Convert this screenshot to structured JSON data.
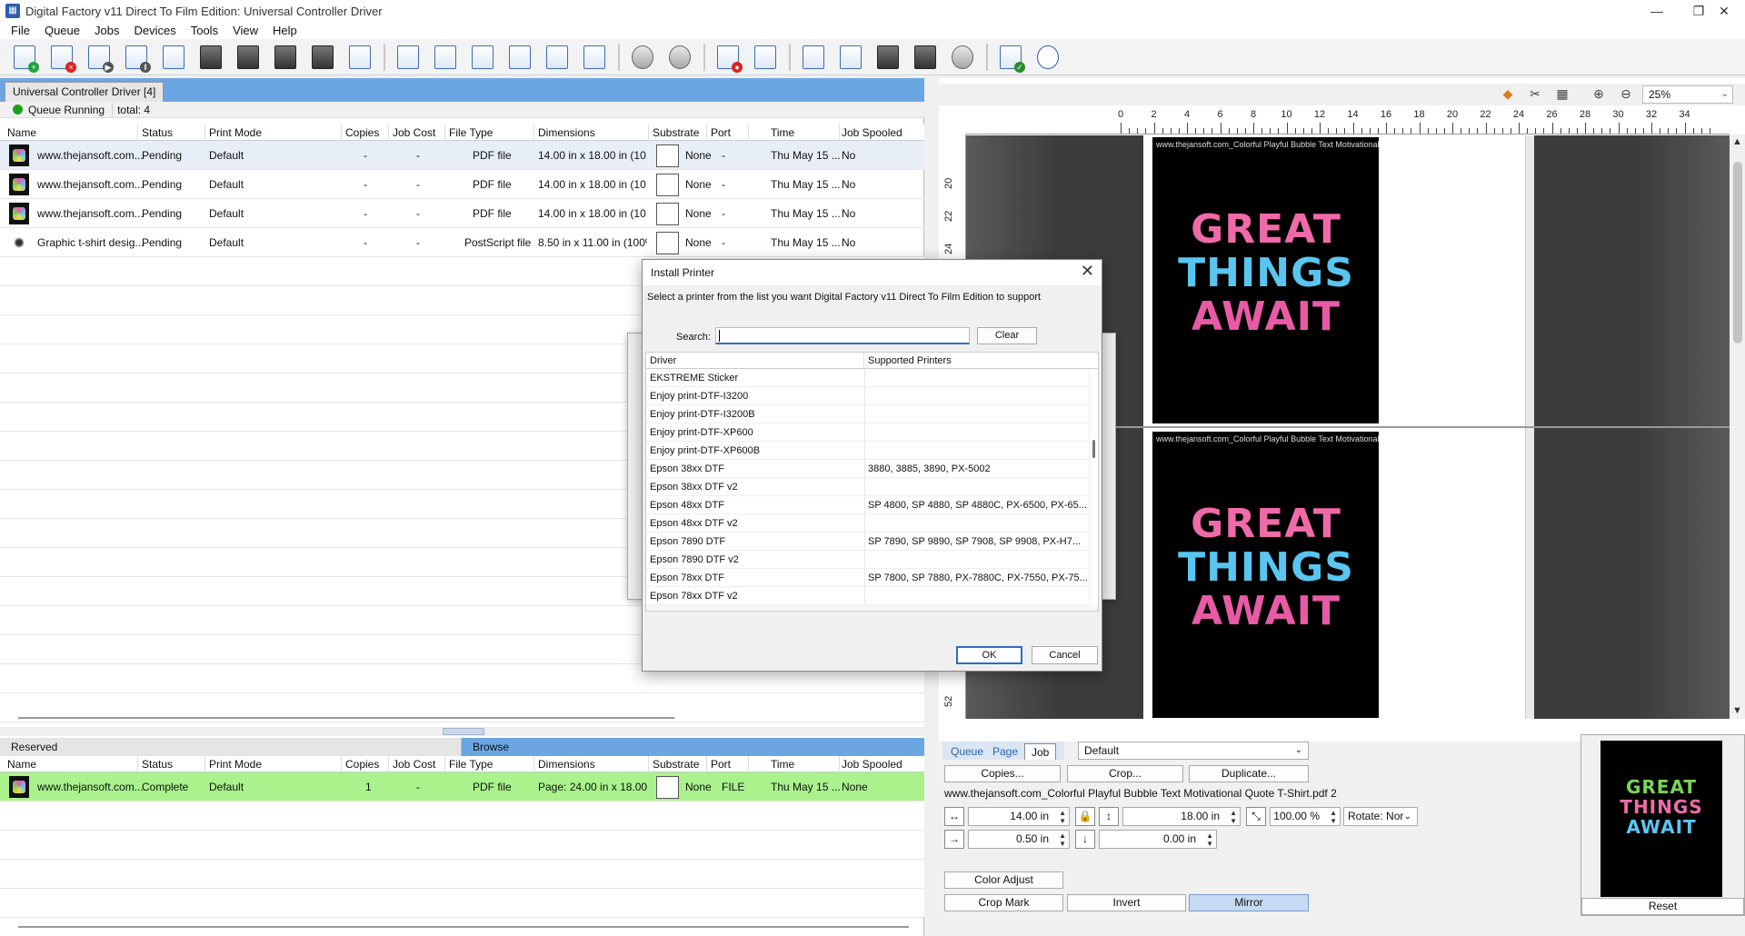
{
  "window": {
    "title": "Digital Factory v11 Direct To Film Edition: Universal Controller Driver",
    "minimize": "—",
    "maximize": "❐",
    "close": "✕"
  },
  "menu": [
    "File",
    "Queue",
    "Jobs",
    "Devices",
    "Tools",
    "View",
    "Help"
  ],
  "toolbar_icons": [
    "add-job-icon",
    "delete-job-icon",
    "play-job-icon",
    "pause-job-icon",
    "copy-job-icon",
    "print-color-icon",
    "rip-icon",
    "edit-pen-icon",
    "printer-pen-icon",
    "window-icon",
    "align-left-icon",
    "align-center-icon",
    "arrow-right-icon",
    "fit-height-icon",
    "fit-both-icon",
    "rotate-icon",
    "stop-gear-icon",
    "cancel-icon",
    "hold-queue-icon",
    "queue-settings-icon",
    "list-icon",
    "checklist-icon",
    "printer-icon",
    "printer-settings-icon",
    "palette-icon",
    "preview-icon",
    "compass-icon"
  ],
  "queue": {
    "tab_label": "Universal Controller Driver [4]",
    "status_text": "Queue Running",
    "total_text": "total: 4",
    "columns": [
      "Name",
      "Status",
      "Print Mode",
      "Copies",
      "Job Cost",
      "File Type",
      "Dimensions",
      "Substrate",
      "Port",
      "Time",
      "Job Spooled"
    ],
    "rows": [
      {
        "name": "www.thejansoft.com...",
        "status": "Pending",
        "mode": "Default",
        "copies": "-",
        "cost": "-",
        "type": "PDF file",
        "dims": "14.00 in x 18.00 in (10...",
        "substrate": "None",
        "port": "-",
        "time": "Thu May 15 ...",
        "spooled": "No"
      },
      {
        "name": "www.thejansoft.com...",
        "status": "Pending",
        "mode": "Default",
        "copies": "-",
        "cost": "-",
        "type": "PDF file",
        "dims": "14.00 in x 18.00 in (10...",
        "substrate": "None",
        "port": "-",
        "time": "Thu May 15 ...",
        "spooled": "No"
      },
      {
        "name": "www.thejansoft.com...",
        "status": "Pending",
        "mode": "Default",
        "copies": "-",
        "cost": "-",
        "type": "PDF file",
        "dims": "14.00 in x 18.00 in (10...",
        "substrate": "None",
        "port": "-",
        "time": "Thu May 15 ...",
        "spooled": "No"
      },
      {
        "name": "Graphic t-shirt desig...",
        "status": "Pending",
        "mode": "Default",
        "copies": "-",
        "cost": "-",
        "type": "PostScript file",
        "dims": "8.50 in x 11.00 in (100%)",
        "substrate": "None",
        "port": "-",
        "time": "Thu May 15 ...",
        "spooled": "No"
      }
    ]
  },
  "reserved": {
    "tab_label": "Reserved",
    "browse_label": "Browse",
    "columns": [
      "Name",
      "Status",
      "Print Mode",
      "Copies",
      "Job Cost",
      "File Type",
      "Dimensions",
      "Substrate",
      "Port",
      "Time",
      "Job Spooled"
    ],
    "rows": [
      {
        "name": "www.thejansoft.com...",
        "status": "Complete",
        "mode": "Default",
        "copies": "1",
        "cost": "-",
        "type": "PDF file",
        "dims": "Page: 24.00 in x 18.00...",
        "substrate": "None",
        "port": "FILE",
        "time": "Thu May 15 ...",
        "spooled": "None"
      }
    ]
  },
  "preview_pane": {
    "zoom": "25%",
    "ruler_h": [
      "0",
      "2",
      "4",
      "6",
      "8",
      "10",
      "12",
      "14",
      "16",
      "18",
      "20",
      "22",
      "24",
      "26",
      "28",
      "30",
      "32",
      "34"
    ],
    "ruler_v": [
      "20",
      "22",
      "24",
      "52"
    ],
    "design_caption": "www.thejansoft.com_Colorful Playful Bubble Text Motivational Qu...",
    "art_lines": [
      "GREAT",
      "THINGS",
      "AWAIT"
    ]
  },
  "properties": {
    "tabs": [
      "Queue",
      "Page",
      "Job"
    ],
    "active_tab": "Job",
    "profile": "Default",
    "copies_btn": "Copies...",
    "crop_btn": "Crop...",
    "duplicate_btn": "Duplicate...",
    "filename": "www.thejansoft.com_Colorful Playful Bubble Text Motivational Quote T-Shirt.pdf 2",
    "width": "14.00 in",
    "height": "18.00 in",
    "scale": "100.00 %",
    "rotate_label": "Rotate:",
    "rotate_value": "Nor",
    "offset_x": "0.50 in",
    "offset_y": "0.00 in",
    "color_adjust": "Color Adjust",
    "crop_mark": "Crop Mark",
    "invert": "Invert",
    "mirror": "Mirror",
    "reset": "Reset"
  },
  "dialog": {
    "title": "Install Printer",
    "message": "Select a printer from the list you want Digital Factory v11 Direct To Film Edition to support",
    "search_label": "Search:",
    "search_value": "",
    "clear_btn": "Clear",
    "col_driver": "Driver",
    "col_supported": "Supported Printers",
    "rows": [
      {
        "driver": "EKSTREME Sticker",
        "supported": ""
      },
      {
        "driver": "Enjoy print-DTF-I3200",
        "supported": ""
      },
      {
        "driver": "Enjoy print-DTF-I3200B",
        "supported": ""
      },
      {
        "driver": "Enjoy print-DTF-XP600",
        "supported": ""
      },
      {
        "driver": "Enjoy print-DTF-XP600B",
        "supported": ""
      },
      {
        "driver": "Epson 38xx DTF",
        "supported": "3880, 3885, 3890, PX-5002"
      },
      {
        "driver": "Epson 38xx DTF v2",
        "supported": ""
      },
      {
        "driver": "Epson 48xx DTF",
        "supported": "SP 4800, SP 4880, SP 4880C, PX-6500, PX-65..."
      },
      {
        "driver": "Epson 48xx DTF v2",
        "supported": ""
      },
      {
        "driver": "Epson 7890 DTF",
        "supported": "SP 7890, SP 9890, SP 7908, SP 9908, PX-H7..."
      },
      {
        "driver": "Epson 7890 DTF v2",
        "supported": ""
      },
      {
        "driver": "Epson 78xx DTF",
        "supported": "SP 7800, SP 7880, PX-7880C, PX-7550, PX-75..."
      },
      {
        "driver": "Epson 78xx DTF v2",
        "supported": ""
      }
    ],
    "ok": "OK",
    "cancel": "Cancel"
  }
}
